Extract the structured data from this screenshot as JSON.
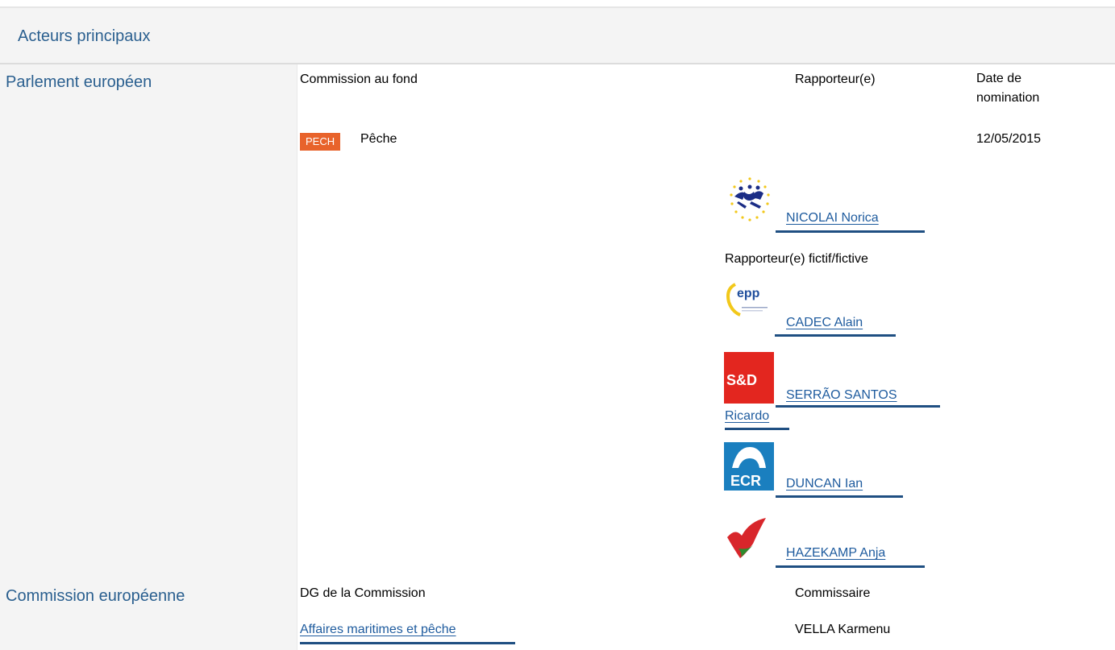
{
  "header": {
    "title": "Acteurs principaux"
  },
  "parliament": {
    "section_title": "Parlement européen",
    "col_committee": "Commission au fond",
    "col_rapporteur": "Rapporteur(e)",
    "col_date": "Date de nomination",
    "committee_badge": "PECH",
    "committee_name": "Pêche",
    "date": "12/05/2015",
    "rapporteur": {
      "name": "NICOLAI Norica",
      "group_icon": "alde-logo-icon"
    },
    "shadow_label": "Rapporteur(e) fictif/fictive",
    "shadows": [
      {
        "name": "CADEC Alain",
        "group_icon": "epp-logo-icon",
        "logo_text": "epp"
      },
      {
        "name": "SERRÃO SANTOS Ricardo",
        "group_icon": "sd-logo-icon",
        "logo_text": "S&D"
      },
      {
        "name": "DUNCAN Ian",
        "group_icon": "ecr-logo-icon",
        "logo_text": "ECR"
      },
      {
        "name": "HAZEKAMP Anja",
        "group_icon": "gue-logo-icon"
      }
    ]
  },
  "commission": {
    "section_title": "Commission européenne",
    "col_dg": "DG de la Commission",
    "col_commissioner": "Commissaire",
    "dg": "Affaires maritimes et pêche",
    "commissioner": "VELLA Karmenu"
  },
  "colors": {
    "accent": "#2a5f8f",
    "badge": "#e8632b",
    "link": "#1e5b9e"
  }
}
